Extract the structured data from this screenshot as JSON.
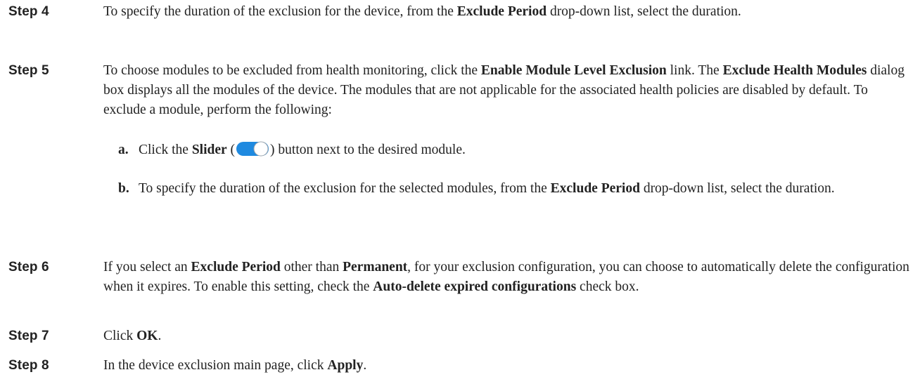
{
  "steps": [
    {
      "label": "Step 4",
      "runs": [
        {
          "t": "To specify the duration of the exclusion for the device, from the "
        },
        {
          "t": "Exclude Period",
          "b": true
        },
        {
          "t": " drop-down list, select the duration."
        }
      ]
    },
    {
      "label": "Step 5",
      "runs": [
        {
          "t": "To choose modules to be excluded from health monitoring, click the "
        },
        {
          "t": "Enable Module Level Exclusion",
          "b": true
        },
        {
          "t": " link. The "
        },
        {
          "t": "Exclude Health Modules",
          "b": true
        },
        {
          "t": " dialog box displays all the modules of the device. The modules that are not applicable for the associated health policies are disabled by default. To exclude a module, perform the following:"
        }
      ],
      "substeps": [
        {
          "letter": "a.",
          "runs": [
            {
              "t": "Click the "
            },
            {
              "t": "Slider",
              "b": true
            },
            {
              "t": " ("
            },
            {
              "icon": "slider-toggle-icon"
            },
            {
              "t": ") button next to the desired module."
            }
          ]
        },
        {
          "letter": "b.",
          "runs": [
            {
              "t": "To specify the duration of the exclusion for the selected modules, from the "
            },
            {
              "t": "Exclude Period",
              "b": true
            },
            {
              "t": " drop-down list, select the duration."
            }
          ]
        }
      ]
    },
    {
      "label": "Step 6",
      "runs": [
        {
          "t": "If you select an "
        },
        {
          "t": "Exclude Period",
          "b": true
        },
        {
          "t": " other than "
        },
        {
          "t": "Permanent",
          "b": true
        },
        {
          "t": ", for your exclusion configuration, you can choose to automatically delete the configuration when it expires. To enable this setting, check the "
        },
        {
          "t": "Auto-delete expired configurations",
          "b": true
        },
        {
          "t": " check box."
        }
      ]
    },
    {
      "label": "Step 7",
      "runs": [
        {
          "t": "Click "
        },
        {
          "t": "OK",
          "b": true
        },
        {
          "t": "."
        }
      ]
    },
    {
      "label": "Step 8",
      "runs": [
        {
          "t": "In the device exclusion main page, click "
        },
        {
          "t": "Apply",
          "b": true
        },
        {
          "t": "."
        }
      ]
    }
  ],
  "colors": {
    "text": "#222222",
    "slider_track": "#1f8ae0",
    "slider_knob": "#ffffff"
  }
}
